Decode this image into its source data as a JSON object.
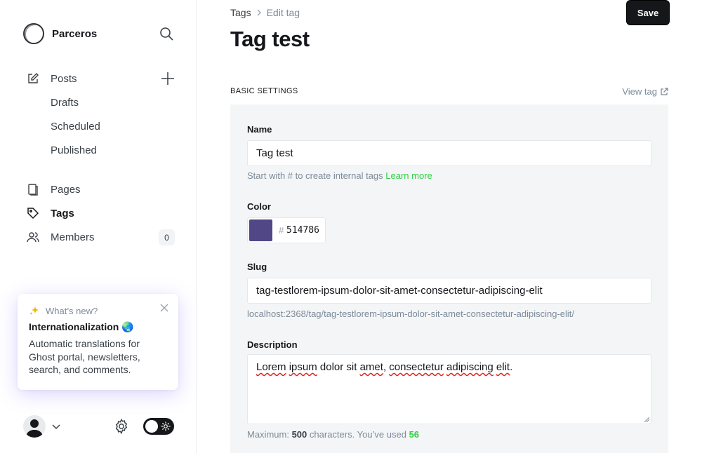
{
  "brand": {
    "name": "Parceros"
  },
  "nav": {
    "posts": "Posts",
    "drafts": "Drafts",
    "scheduled": "Scheduled",
    "published": "Published",
    "pages": "Pages",
    "tags": "Tags",
    "members": "Members",
    "members_count": "0"
  },
  "whats_new": {
    "heading": "What’s new?",
    "title": "Internationalization 🌏",
    "body": "Automatic translations for Ghost portal, newsletters, search, and comments."
  },
  "breadcrumb": {
    "parent": "Tags",
    "current": "Edit tag"
  },
  "toolbar": {
    "save_label": "Save"
  },
  "page": {
    "title": "Tag test"
  },
  "section": {
    "label": "Basic settings",
    "view_link": "View tag"
  },
  "form": {
    "name_label": "Name",
    "name_value": "Tag test",
    "name_hint": "Start with # to create internal tags",
    "name_hint_link": "Learn more",
    "color_label": "Color",
    "color_hash": "#",
    "color_value": "514786",
    "color_hex": "#514786",
    "slug_label": "Slug",
    "slug_value": "tag-testlorem-ipsum-dolor-sit-amet-consectetur-adipiscing-elit",
    "slug_url": "localhost:2368/tag/tag-testlorem-ipsum-dolor-sit-amet-consectetur-adipiscing-elit/",
    "description_label": "Description",
    "description_value": {
      "w1": "Lorem",
      "w2": "ipsum",
      "w3": "dolor sit",
      "w4": "amet",
      "w5": ",",
      "w6": "consectetur",
      "w7": "adipiscing",
      "w8": "elit",
      "w9": "."
    },
    "desc_hint_prefix": "Maximum:",
    "desc_hint_max": "500",
    "desc_hint_mid": "characters. You’ve used",
    "desc_hint_used": "56"
  },
  "icons": {
    "search": "search-icon",
    "posts": "edit-icon",
    "add": "plus-icon",
    "pages": "pages-icon",
    "tags": "tag-icon",
    "members": "members-icon",
    "sparkle": "sparkle-icon",
    "close": "close-icon",
    "settings": "gear-icon",
    "external": "external-link-icon"
  },
  "colors": {
    "accent_green": "#30cf43",
    "tag_color": "#514786",
    "dark": "#15171a"
  }
}
